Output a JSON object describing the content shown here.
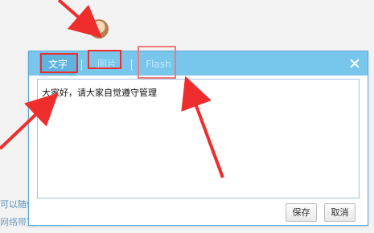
{
  "background": {
    "line_1": "可以随便",
    "line_2": "网络带宽占用体验"
  },
  "dialog": {
    "tabs": [
      {
        "label": "文字"
      },
      {
        "label": "图片"
      },
      {
        "label": "Flash"
      }
    ],
    "content_text": "大家好，请大家自觉遵守管理",
    "save_label": "保存",
    "cancel_label": "取消"
  },
  "colors": {
    "titlebar": "#79c6ec",
    "active_tab": "#5fb3df",
    "annotation": "#ef2d2d"
  }
}
